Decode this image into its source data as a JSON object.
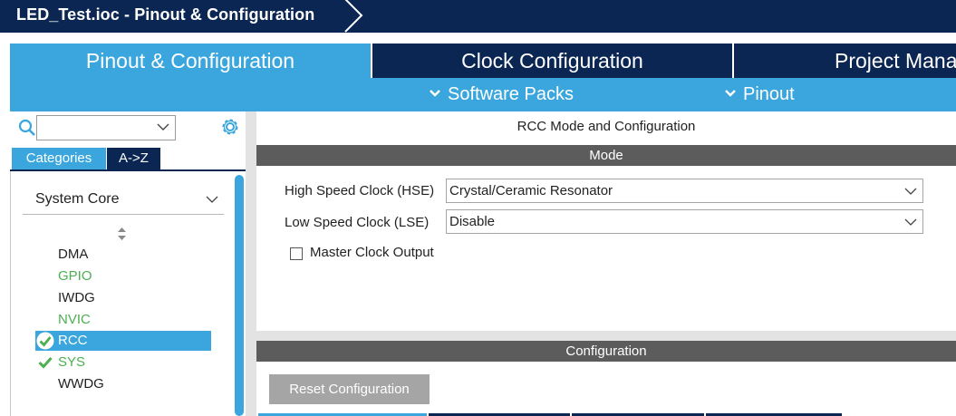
{
  "window": {
    "title": "LED_Test.ioc - Pinout & Configuration"
  },
  "colors": {
    "navy": "#0b2652",
    "accent": "#3aa6dd",
    "green": "#4caf50",
    "bar": "#5c5c5c"
  },
  "tabs": [
    {
      "label": "Pinout & Configuration",
      "active": true
    },
    {
      "label": "Clock Configuration",
      "active": false
    },
    {
      "label": "Project Mana",
      "active": false
    }
  ],
  "subbar": {
    "software_packs": "Software Packs",
    "pinout": "Pinout"
  },
  "left_panel": {
    "search": {
      "value": ""
    },
    "view_tabs": {
      "categories": "Categories",
      "az": "A->Z"
    },
    "group": {
      "label": "System Core"
    },
    "items": [
      {
        "label": "DMA",
        "status": "none"
      },
      {
        "label": "GPIO",
        "status": "configured"
      },
      {
        "label": "IWDG",
        "status": "none"
      },
      {
        "label": "NVIC",
        "status": "configured"
      },
      {
        "label": "RCC",
        "status": "selected-ok"
      },
      {
        "label": "SYS",
        "status": "ok"
      },
      {
        "label": "WWDG",
        "status": "none"
      }
    ]
  },
  "main": {
    "title": "RCC Mode and Configuration",
    "mode_header": "Mode",
    "hse": {
      "label": "High Speed Clock (HSE)",
      "value": "Crystal/Ceramic Resonator"
    },
    "lse": {
      "label": "Low Speed Clock (LSE)",
      "value": "Disable"
    },
    "mco": {
      "label": "Master Clock Output",
      "checked": false
    },
    "config_header": "Configuration",
    "reset_button": "Reset Configuration"
  }
}
